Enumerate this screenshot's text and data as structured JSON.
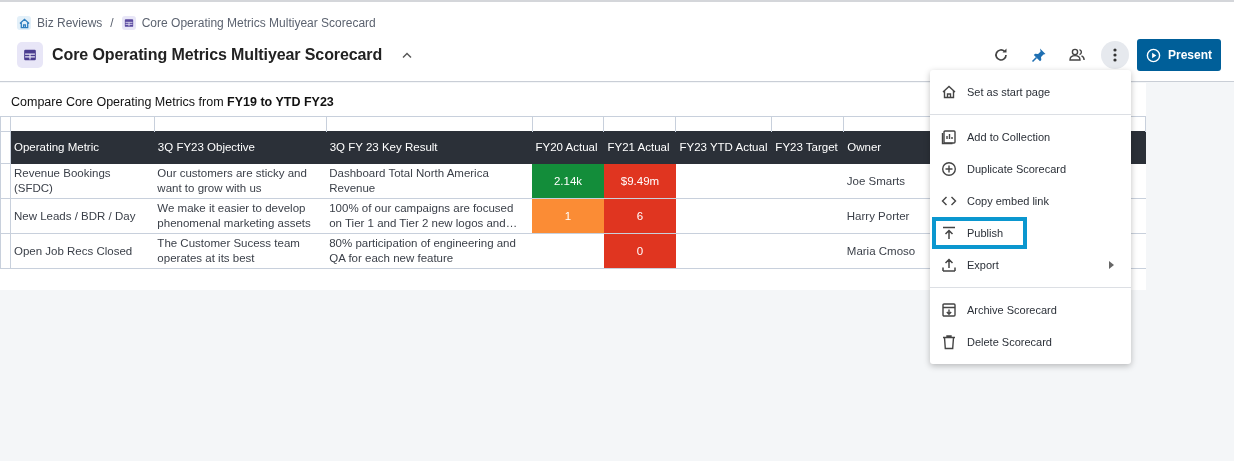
{
  "breadcrumb_separator": "/",
  "breadcrumbs": [
    {
      "label": "Biz Reviews",
      "kind": "home"
    },
    {
      "label": "Core Operating Metrics Multiyear Scorecard",
      "kind": "scorecard"
    }
  ],
  "title": "Core Operating Metrics Multiyear Scorecard",
  "toolbar": {
    "more_selected": true,
    "present_label": "Present"
  },
  "scorecard": {
    "caption": "Compare Core Operating Metrics from **FY19 to YTD FY23**",
    "columns": [
      "Operating Metric",
      "3Q FY23 Objective",
      "3Q FY 23 Key Result",
      "FY20 Actual",
      "FY21 Actual",
      "FY23 YTD Actual",
      "FY23 Target",
      "Owner"
    ],
    "rows": [
      {
        "cells": [
          {
            "text": "Revenue Bookings (SFDC)"
          },
          {
            "text": "Our customers are sticky and want to grow with us"
          },
          {
            "text": "Dashboard Total North America Revenue"
          },
          {
            "text": "2.14k",
            "color": "#138d3a"
          },
          {
            "text": "$9.49m",
            "color": "#e03520"
          },
          {
            "text": ""
          },
          {
            "text": ""
          },
          {
            "text": "Joe Smarts"
          }
        ]
      },
      {
        "cells": [
          {
            "text": "New Leads / BDR / Day"
          },
          {
            "text": "We make it easier to develop phenomenal marketing assets"
          },
          {
            "text": "100% of our campaigns are focused on Tier 1 and Tier 2 new logos and…"
          },
          {
            "text": "1",
            "color": "#fb8c35"
          },
          {
            "text": "6",
            "color": "#e03520"
          },
          {
            "text": ""
          },
          {
            "text": ""
          },
          {
            "text": "Harry Porter"
          }
        ]
      },
      {
        "cells": [
          {
            "text": "Open Job Recs Closed"
          },
          {
            "text": "The Customer Sucess team operates at its best"
          },
          {
            "text": "80% participation of engineering and QA for each new feature"
          },
          {
            "text": ""
          },
          {
            "text": "0",
            "color": "#e03520"
          },
          {
            "text": ""
          },
          {
            "text": ""
          },
          {
            "text": "Maria Cmoso"
          }
        ]
      }
    ]
  },
  "menu": {
    "groups": [
      [
        {
          "label": "Set as start page",
          "highlighted": false,
          "has_submenu": false
        }
      ],
      [
        {
          "label": "Add to Collection",
          "highlighted": false,
          "has_submenu": false
        },
        {
          "label": "Duplicate Scorecard",
          "highlighted": false,
          "has_submenu": false
        },
        {
          "label": "Copy embed link",
          "highlighted": false,
          "has_submenu": false
        },
        {
          "label": "Publish",
          "highlighted": true,
          "has_submenu": false
        },
        {
          "label": "Export",
          "highlighted": false,
          "has_submenu": true
        }
      ],
      [
        {
          "label": "Archive Scorecard",
          "highlighted": false,
          "has_submenu": false
        },
        {
          "label": "Delete Scorecard",
          "highlighted": false,
          "has_submenu": false
        }
      ]
    ]
  }
}
